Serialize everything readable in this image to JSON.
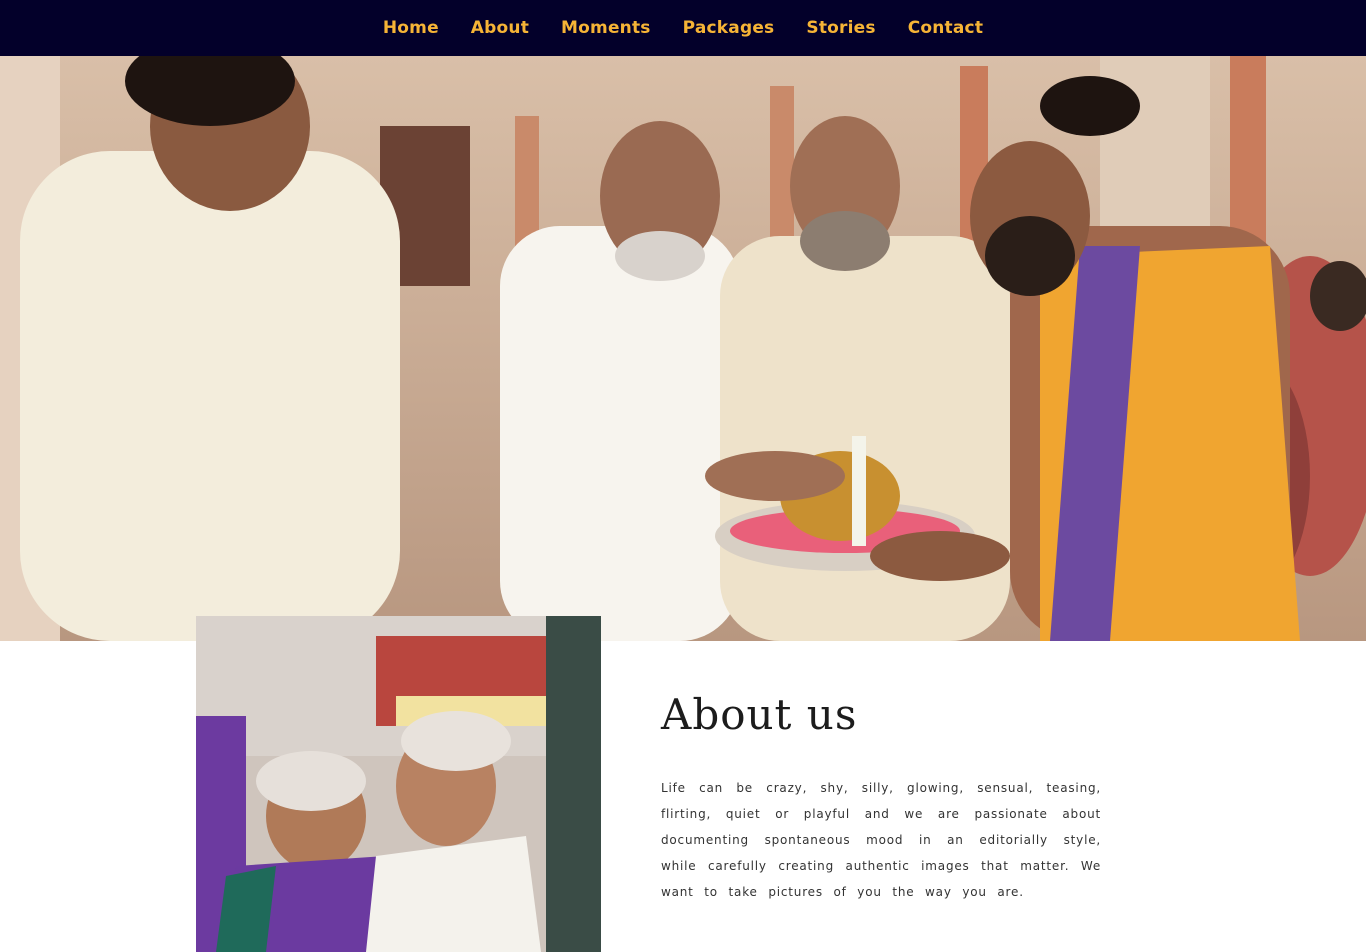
{
  "nav": {
    "items": [
      {
        "label": "Home"
      },
      {
        "label": "About"
      },
      {
        "label": "Moments"
      },
      {
        "label": "Packages"
      },
      {
        "label": "Stories"
      },
      {
        "label": "Contact"
      }
    ]
  },
  "about": {
    "title": "About us",
    "body": "Life can be crazy, shy, silly, glowing, sensual, teasing, flirting, quiet or playful and we are passionate about documenting spontaneous mood in an editorially style, while carefully creating authentic images that matter. We want to take pictures of you the way you are."
  },
  "colors": {
    "nav_background": "#03002a",
    "nav_link": "#f6b436"
  }
}
